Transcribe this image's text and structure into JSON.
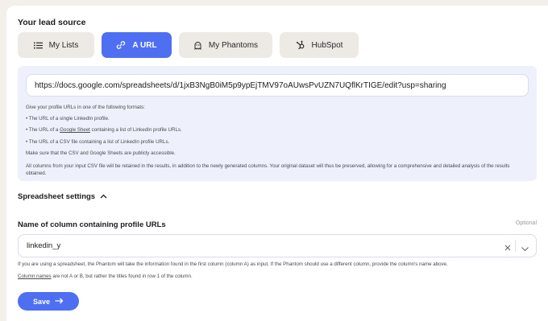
{
  "lead_source": {
    "title": "Your lead source",
    "tabs": [
      {
        "label": "My Lists",
        "icon": "list-icon",
        "active": false
      },
      {
        "label": "A URL",
        "icon": "link-icon",
        "active": true
      },
      {
        "label": "My Phantoms",
        "icon": "phantom-icon",
        "active": false
      },
      {
        "label": "HubSpot",
        "icon": "hubspot-icon",
        "active": false
      }
    ]
  },
  "url_panel": {
    "url_value": "https://docs.google.com/spreadsheets/d/1jxB3NgB0iM5p9ypEjTMV97oAUwsPvUZN7UQflKrTIGE/edit?usp=sharing",
    "help_intro": "Give your profile URLs in one of the following formats:",
    "help_item_1": "• The URL of a single LinkedIn profile.",
    "help_item_2_pre": "• The URL of a ",
    "help_item_2_link": "Google Sheet",
    "help_item_2_post": " containing a list of LinkedIn profile URLs.",
    "help_item_3": "• The URL of a CSV file containing a list of LinkedIn profile URLs.",
    "help_public": "Make sure that the CSV and Google Sheets are publicly accessible.",
    "help_columns": "All columns from your input CSV file will be retained in the results, in addition to the newly generated columns. Your original dataset will thus be preserved, allowing for a comprehensive and detailed analysis of the results obtained."
  },
  "spreadsheet_settings": {
    "label": "Spreadsheet settings",
    "expanded": true,
    "column_field": {
      "label": "Name of column containing profile URLs",
      "optional_label": "Optional",
      "value": "linkedin_y"
    },
    "note_1": "If you are using a spreadsheet, the Phantom will take the information found in the first column (column A) as input. If the Phantom should use a different column, provide the column's name above.",
    "note_2_link": "Column names",
    "note_2_rest": " are not A or B, but rather the titles found in row 1 of the column."
  },
  "save_button": {
    "label": "Save",
    "icon": "arrow-right-icon"
  },
  "colors": {
    "accent": "#4f6ff2",
    "panel": "#eef1fc",
    "tab_bg": "#ede9e4",
    "page_bg": "#f3efea"
  }
}
